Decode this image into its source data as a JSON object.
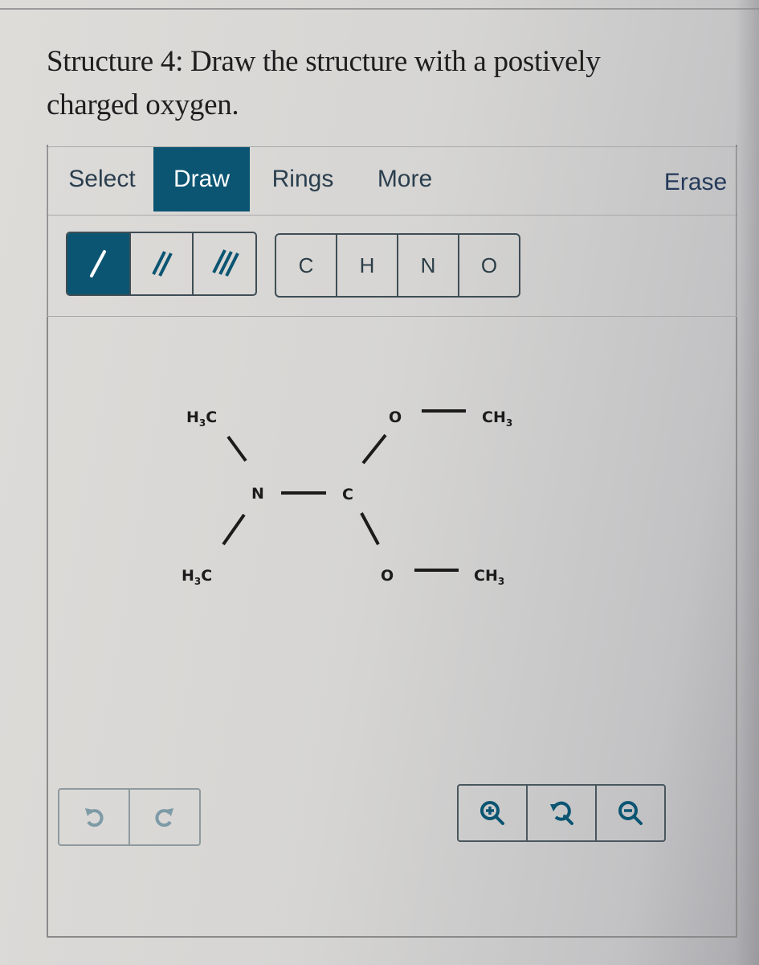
{
  "question": {
    "text": "Structure 4: Draw the structure with a postively charged oxygen."
  },
  "tabs": [
    {
      "label": "Select",
      "active": false
    },
    {
      "label": "Draw",
      "active": true
    },
    {
      "label": "Rings",
      "active": false
    },
    {
      "label": "More",
      "active": false
    }
  ],
  "erase_label": "Erase",
  "bond_buttons": [
    {
      "icon": "single-bond-icon",
      "active": true
    },
    {
      "icon": "double-bond-icon",
      "active": false
    },
    {
      "icon": "triple-bond-icon",
      "active": false
    }
  ],
  "atom_buttons": [
    "C",
    "H",
    "N",
    "O"
  ],
  "molecule": {
    "atoms": {
      "h3c_top": {
        "main": "H",
        "sub": "3",
        "tail": "C"
      },
      "h3c_bottom": {
        "main": "H",
        "sub": "3",
        "tail": "C"
      },
      "n": "N",
      "c": "C",
      "o_top": "O",
      "o_bottom": "O",
      "ch3_top": {
        "main": "CH",
        "sub": "3"
      },
      "ch3_bottom": {
        "main": "CH",
        "sub": "3"
      }
    },
    "bonds": [
      [
        "h3c_top",
        "n",
        "single"
      ],
      [
        "h3c_bottom",
        "n",
        "single"
      ],
      [
        "n",
        "c",
        "single"
      ],
      [
        "c",
        "o_top",
        "single"
      ],
      [
        "c",
        "o_bottom",
        "single"
      ],
      [
        "o_top",
        "ch3_top",
        "single"
      ],
      [
        "o_bottom",
        "ch3_bottom",
        "single"
      ]
    ]
  },
  "history_buttons": [
    "undo-icon",
    "redo-icon"
  ],
  "zoom_buttons": [
    "zoom-in-icon",
    "zoom-reset-icon",
    "zoom-out-icon"
  ],
  "colors": {
    "accent": "#0b5572",
    "text_dark": "#2a3e4e"
  }
}
